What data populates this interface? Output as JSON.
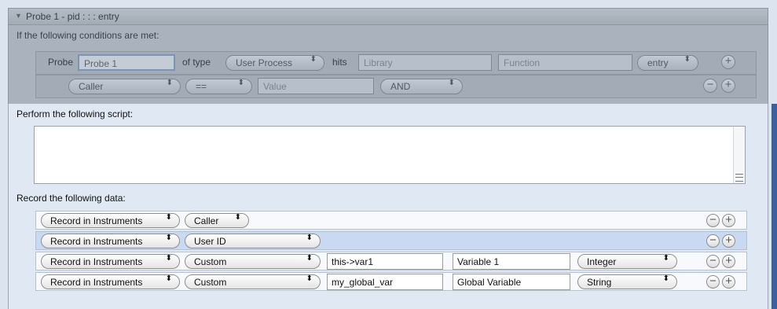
{
  "probe_header": {
    "title": "Probe 1 - pid : : : entry"
  },
  "conditions": {
    "label": "If the following conditions are met:",
    "row1": {
      "probe_label": "Probe",
      "probe_value": "Probe 1",
      "of_type_label": "of type",
      "type_value": "User Process",
      "hits_label": "hits",
      "library_placeholder": "Library",
      "function_placeholder": "Function",
      "entry_value": "entry"
    },
    "row2": {
      "caller_value": "Caller",
      "operator_value": "==",
      "value_placeholder": "Value",
      "logic_value": "AND"
    }
  },
  "script": {
    "label": "Perform the following script:"
  },
  "record": {
    "label": "Record the following data:",
    "rows": [
      {
        "destination": "Record in Instruments",
        "data": "Caller"
      },
      {
        "destination": "Record in Instruments",
        "data": "User ID"
      },
      {
        "destination": "Record in Instruments",
        "data": "Custom",
        "expression": "this->var1",
        "name": "Variable 1",
        "type": "Integer"
      },
      {
        "destination": "Record in Instruments",
        "data": "Custom",
        "expression": "my_global_var",
        "name": "Global Variable",
        "type": "String"
      }
    ]
  },
  "glyphs": {
    "minus": "−",
    "plus": "+",
    "up_down": "⬍",
    "triangle": "▼"
  },
  "colors": {
    "selected_row": "#c9d9f2",
    "dimmed_background": "#aab3bd"
  }
}
